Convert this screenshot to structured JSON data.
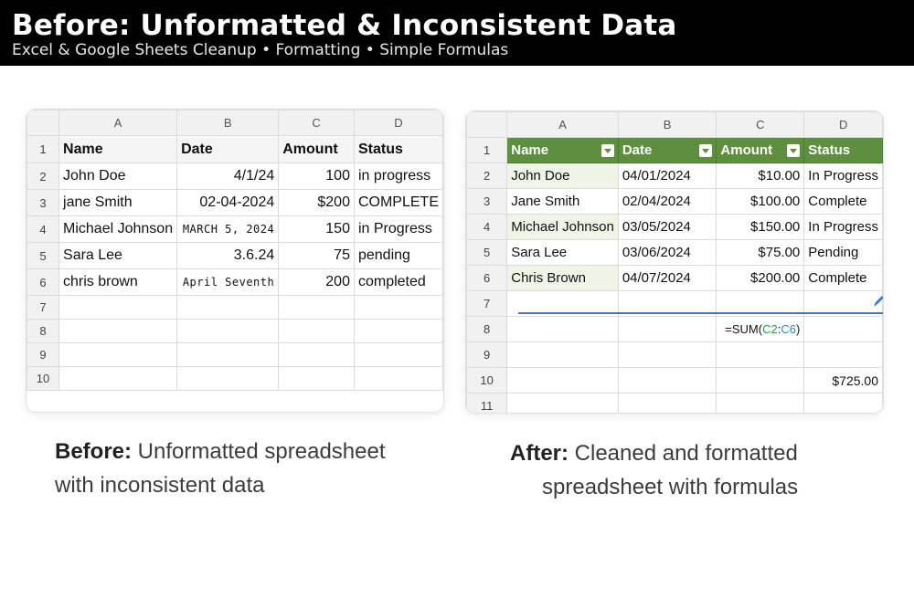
{
  "banner": {
    "title": "Before: Unformatted & Inconsistent Data",
    "subtitle": "Excel & Google Sheets Cleanup • Formatting • Simple Formulas"
  },
  "before_sheet": {
    "columns": [
      "A",
      "B",
      "C",
      "D"
    ],
    "row_numbers": [
      "1",
      "2",
      "3",
      "4",
      "5",
      "6",
      "7",
      "8",
      "9",
      "10"
    ],
    "header": [
      "Name",
      "Date",
      "Amount",
      "Status"
    ],
    "rows": [
      [
        "John Doe",
        "4/1/24",
        "100",
        "in progress"
      ],
      [
        "jane Smith",
        "02-04-2024",
        "$200",
        "COMPLETE"
      ],
      [
        "Michael Johnson",
        "MARCH 5, 2024",
        "150",
        "in Progress"
      ],
      [
        "Sara Lee",
        "3.6.24",
        "75",
        "pending"
      ],
      [
        "chris brown",
        "April Seventh",
        "200",
        "completed"
      ]
    ]
  },
  "after_sheet": {
    "columns": [
      "A",
      "B",
      "C",
      "D"
    ],
    "row_numbers": [
      "1",
      "2",
      "3",
      "4",
      "5",
      "6",
      "7",
      "8",
      "9",
      "10",
      "11"
    ],
    "header": [
      "Name",
      "Date",
      "Amount",
      "Status"
    ],
    "rows": [
      [
        "John Doe",
        "04/01/2024",
        "$10.00",
        "In Progress"
      ],
      [
        "Jane Smith",
        "02/04/2024",
        "$100.00",
        "Complete"
      ],
      [
        "Michael Johnson",
        "03/05/2024",
        "$150.00",
        "In Progress"
      ],
      [
        "Sara Lee",
        "03/06/2024",
        "$75.00",
        "Pending"
      ],
      [
        "Chris Brown",
        "04/07/2024",
        "$200.00",
        "Complete"
      ]
    ],
    "formula_prefix": "=SUM(",
    "formula_ref_start": "C2",
    "formula_colon": ":",
    "formula_ref_end": "C6",
    "formula_suffix": ")",
    "total": "$725.00",
    "header_color": "#5d8f3f"
  },
  "captions": {
    "before_bold": "Before:",
    "before_line1": " Unformatted spreadsheet",
    "before_line2": "with inconsistent data",
    "after_bold": "After:",
    "after_line1": " Cleaned and formatted",
    "after_line2": "spreadsheet with formulas"
  }
}
